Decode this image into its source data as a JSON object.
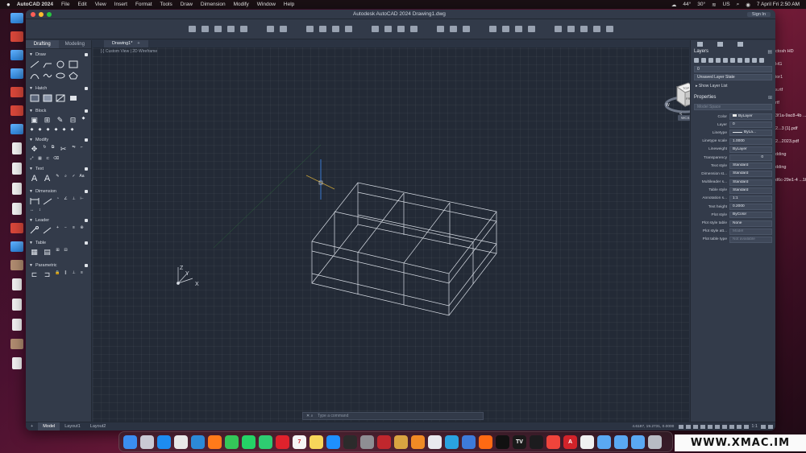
{
  "menubar": {
    "app": "AutoCAD 2024",
    "items": [
      "File",
      "Edit",
      "View",
      "Insert",
      "Format",
      "Tools",
      "Draw",
      "Dimension",
      "Modify",
      "Window",
      "Help"
    ],
    "temp1": "44°",
    "temp2": "30°",
    "locale": "US",
    "datetime": "7 April Fri 2:50 AM"
  },
  "desktop_right": [
    "ctosh HD",
    "HG",
    "ior1",
    "s.rtf",
    "rtf",
    "3f1a-9ac8-4b\n...e540.jpg",
    "2...3 [1].pdf",
    "2...2023.pdf",
    "dding",
    "dding",
    "d6c-29e1-4\n...1fbfb.JPG"
  ],
  "window": {
    "title": "Autodesk AutoCAD 2024   Drawing1.dwg",
    "sign_in": "Sign In"
  },
  "palette": {
    "tabs": [
      "Drafting",
      "Modeling"
    ],
    "sections": [
      "Draw",
      "Hatch",
      "Block",
      "Modify",
      "Text",
      "Dimension",
      "Leader",
      "Table",
      "Parametric"
    ]
  },
  "canvas": {
    "file_tab": "Drawing1*",
    "file_tab_add": "+",
    "viewport_label": "[-]  Custom View  |  2D Wireframe",
    "cmd_icons": "✕  ⌕",
    "cmd_placeholder": "Type a command"
  },
  "viewcube": {
    "top": "TOP",
    "front": "FRONT",
    "compass_w": "W",
    "compass_s": "S",
    "compass_e": "E",
    "wcs": "WCS"
  },
  "ucs": {
    "x": "X",
    "y": "Y",
    "z": "Z"
  },
  "layers": {
    "title": "Layers",
    "current_layer": "0",
    "layer_state": "Unsaved Layer State",
    "show_list": "Show Layer List"
  },
  "properties": {
    "title": "Properties",
    "space": "Model Space",
    "rows": [
      {
        "label": "Color",
        "value": "ByLayer"
      },
      {
        "label": "Layer",
        "value": "0"
      },
      {
        "label": "Linetype",
        "value": "ByLa..."
      },
      {
        "label": "Linetype scale",
        "value": "1.0000"
      },
      {
        "label": "Lineweight",
        "value": "ByLayer"
      },
      {
        "label": "Transparency",
        "value": "0"
      },
      {
        "label": "Text style",
        "value": "Standard"
      },
      {
        "label": "Dimension st...",
        "value": "Standard"
      },
      {
        "label": "Multileader s...",
        "value": "Standard"
      },
      {
        "label": "Table style",
        "value": "Standard"
      },
      {
        "label": "Annotation s...",
        "value": "1:1"
      },
      {
        "label": "Text height",
        "value": "0.2000"
      },
      {
        "label": "Plot style",
        "value": "ByColor"
      },
      {
        "label": "Plot style table",
        "value": "None"
      },
      {
        "label": "Plot style att...",
        "value": "Model"
      },
      {
        "label": "Plot table type",
        "value": "Not available"
      }
    ]
  },
  "statusbar": {
    "tabs": [
      "Model",
      "Layout1",
      "Layout2"
    ],
    "coords": "4.6187, 19.2731, 0.0000",
    "scale": "1:1"
  },
  "dock": {
    "apps": [
      {
        "name": "finder",
        "color": "#3b8ef0",
        "label": ""
      },
      {
        "name": "launchpad",
        "color": "#c9c9d4",
        "label": ""
      },
      {
        "name": "safari",
        "color": "#1d8cf0",
        "label": ""
      },
      {
        "name": "chrome",
        "color": "#e8e8e8",
        "label": ""
      },
      {
        "name": "edge",
        "color": "#2c8ad8",
        "label": ""
      },
      {
        "name": "firefox",
        "color": "#ff7a1a",
        "label": ""
      },
      {
        "name": "messages",
        "color": "#34c759",
        "label": ""
      },
      {
        "name": "whatsapp",
        "color": "#25d366",
        "label": ""
      },
      {
        "name": "facetime",
        "color": "#2ecc71",
        "label": ""
      },
      {
        "name": "opera",
        "color": "#e0222c",
        "label": ""
      },
      {
        "name": "calendar",
        "color": "#f5f5f5",
        "label": "7"
      },
      {
        "name": "notes",
        "color": "#f7d65a",
        "label": ""
      },
      {
        "name": "appstore",
        "color": "#1e90ff",
        "label": ""
      },
      {
        "name": "terminal",
        "color": "#2b2b2b",
        "label": ""
      },
      {
        "name": "settings",
        "color": "#8e8e93",
        "label": ""
      },
      {
        "name": "filezilla",
        "color": "#c0272d",
        "label": ""
      },
      {
        "name": "archiver",
        "color": "#d9a441",
        "label": ""
      },
      {
        "name": "vlc",
        "color": "#f08a24",
        "label": ""
      },
      {
        "name": "photos",
        "color": "#e9e9ee",
        "label": ""
      },
      {
        "name": "telegram",
        "color": "#2aa3e0",
        "label": ""
      },
      {
        "name": "cloud",
        "color": "#3d7bd9",
        "label": ""
      },
      {
        "name": "compass",
        "color": "#ff6a13",
        "label": ""
      },
      {
        "name": "capcut",
        "color": "#111111",
        "label": ""
      },
      {
        "name": "tradingview",
        "color": "#1a1a1a",
        "label": "TV"
      },
      {
        "name": "music",
        "color": "#1c1c1e",
        "label": ""
      },
      {
        "name": "anydesk",
        "color": "#ef443b",
        "label": ""
      },
      {
        "name": "autocad",
        "color": "#d2232a",
        "label": "A"
      },
      {
        "name": "preview",
        "color": "#f0f0f0",
        "label": ""
      },
      {
        "name": "downloads-folder",
        "color": "#5aa8f2",
        "label": ""
      },
      {
        "name": "documents-folder",
        "color": "#5aa8f2",
        "label": ""
      },
      {
        "name": "apps-folder",
        "color": "#5aa8f2",
        "label": ""
      },
      {
        "name": "trash",
        "color": "#b8bcc4",
        "label": ""
      }
    ]
  },
  "watermark": "WWW.XMAC.IM"
}
